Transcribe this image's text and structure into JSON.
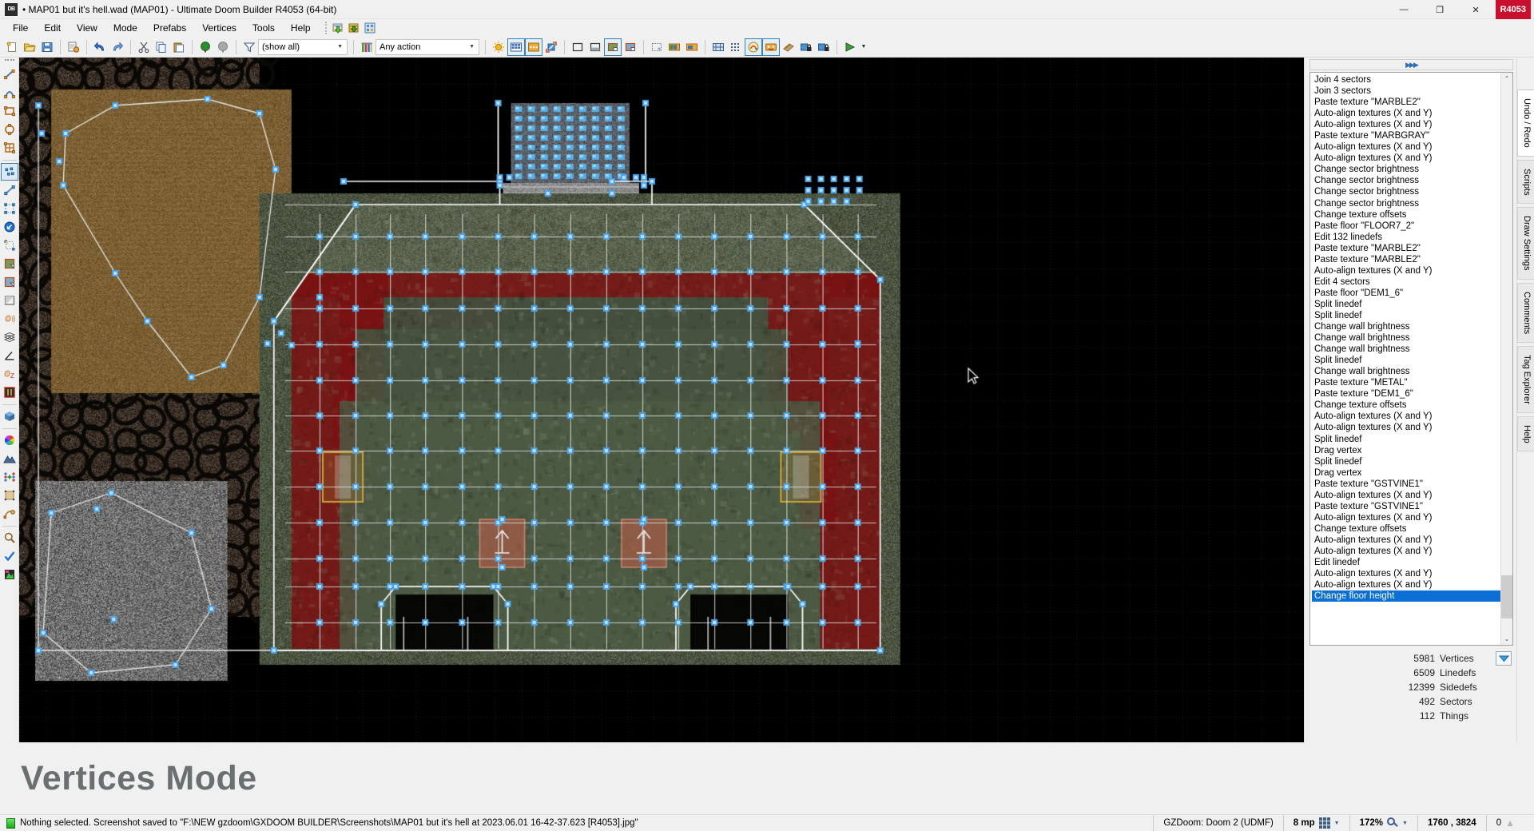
{
  "window": {
    "title": "• MAP01 but it's hell.wad (MAP01) - Ultimate Doom Builder R4053 (64-bit)",
    "app_icon_label": "DB",
    "minimize": "—",
    "maximize": "❐",
    "close": "✕",
    "revision_badge": "R4053"
  },
  "menubar": {
    "items": [
      {
        "label": "File",
        "name": "menu-file"
      },
      {
        "label": "Edit",
        "name": "menu-edit"
      },
      {
        "label": "View",
        "name": "menu-view"
      },
      {
        "label": "Mode",
        "name": "menu-mode"
      },
      {
        "label": "Prefabs",
        "name": "menu-prefabs"
      },
      {
        "label": "Vertices",
        "name": "menu-vertices"
      },
      {
        "label": "Tools",
        "name": "menu-tools"
      },
      {
        "label": "Help",
        "name": "menu-help"
      }
    ],
    "icons": [
      {
        "name": "import-wad-icon"
      },
      {
        "name": "export-wad-icon"
      },
      {
        "name": "script-editor-icon"
      }
    ]
  },
  "toolbar": {
    "groups": [
      {
        "name": "file-group",
        "buttons": [
          {
            "name": "new-map-button",
            "icon": "new-map-icon"
          },
          {
            "name": "open-map-button",
            "icon": "open-folder-icon"
          },
          {
            "name": "save-map-button",
            "icon": "floppy-save-icon"
          }
        ]
      },
      {
        "name": "map-options-group",
        "buttons": [
          {
            "name": "map-options-button",
            "icon": "map-options-icon"
          }
        ]
      },
      {
        "name": "undo-redo-group",
        "buttons": [
          {
            "name": "undo-button",
            "icon": "undo-arrow-icon"
          },
          {
            "name": "redo-button",
            "icon": "redo-arrow-icon"
          }
        ]
      },
      {
        "name": "clipboard-group",
        "buttons": [
          {
            "name": "cut-button",
            "icon": "scissors-icon"
          },
          {
            "name": "copy-button",
            "icon": "copy-icon"
          },
          {
            "name": "paste-button",
            "icon": "paste-icon"
          }
        ]
      },
      {
        "name": "thing-filter-group",
        "buttons": [
          {
            "name": "snap-to-grid-button",
            "icon": "green-tree-icon"
          },
          {
            "name": "auto-merge-button",
            "icon": "gray-tree-icon"
          }
        ]
      }
    ],
    "thing_filter": {
      "name": "thing-filter-combo",
      "value": "(show all)",
      "placeholder": "(show all)"
    },
    "action_filter": {
      "name": "action-filter-combo",
      "value": "Any action",
      "placeholder": "Any action",
      "icon": "pillars-icon"
    },
    "view_modes": [
      {
        "name": "view-brightness-button",
        "icon": "sun-icon",
        "checked": false
      },
      {
        "name": "view-floor-textures-button",
        "icon": "blue-grid-icon",
        "checked": true
      },
      {
        "name": "view-ceiling-textures-button",
        "icon": "orange-grid-icon",
        "checked": true
      },
      {
        "name": "view-normal-button",
        "icon": "blue-arrows-icon",
        "checked": false
      }
    ],
    "render_modes": [
      {
        "name": "render-wireframe-button",
        "icon": "wireframe-icon",
        "checked": false
      },
      {
        "name": "render-brightness-button",
        "icon": "brightness-icon",
        "checked": false
      },
      {
        "name": "render-floors-button",
        "icon": "floors-icon",
        "checked": true
      },
      {
        "name": "render-ceilings-button",
        "icon": "ceilings-icon",
        "checked": false
      }
    ],
    "selection_modes": [
      {
        "name": "dynamic-grid-button",
        "icon": "dotted-square-icon",
        "checked": false
      },
      {
        "name": "show-lights-button",
        "icon": "lights-icon",
        "checked": false
      },
      {
        "name": "show-models-button",
        "icon": "models-icon",
        "checked": false
      }
    ],
    "extra_modes": [
      {
        "name": "snap-vertices-button",
        "icon": "snap-icon",
        "checked": false
      },
      {
        "name": "grid-setup-button",
        "icon": "grid-dots-icon",
        "checked": false
      },
      {
        "name": "test-map-sound-button",
        "icon": "sound-prop-icon",
        "checked": true
      },
      {
        "name": "show-comments-button",
        "icon": "comments-face-icon",
        "checked": true
      },
      {
        "name": "texture-browse-button",
        "icon": "texture-icon",
        "checked": false
      },
      {
        "name": "lock-textures-button",
        "icon": "lock-blue-icon",
        "checked": false
      },
      {
        "name": "lock-heights-button",
        "icon": "lock-blue2-icon",
        "checked": false
      }
    ],
    "test_group": [
      {
        "name": "test-map-button",
        "icon": "green-play-icon"
      },
      {
        "name": "test-map-dropdown",
        "icon": "chevron-down-icon"
      }
    ]
  },
  "left_toolbar": {
    "items": [
      {
        "name": "draw-lines-tool",
        "icon": "draw-line-icon",
        "checked": false
      },
      {
        "name": "draw-curve-tool",
        "icon": "draw-curve-icon",
        "checked": false
      },
      {
        "name": "draw-rectangle-tool",
        "icon": "draw-rectangle-icon",
        "checked": false
      },
      {
        "name": "draw-ellipse-tool",
        "icon": "draw-ellipse-icon",
        "checked": false
      },
      {
        "name": "draw-grid-tool",
        "icon": "draw-grid-icon",
        "checked": false
      },
      {
        "name": "vertices-mode-tool",
        "icon": "vertices-mode-icon",
        "checked": true
      },
      {
        "name": "linedefs-mode-tool",
        "icon": "linedefs-mode-icon",
        "checked": false
      },
      {
        "name": "sectors-mode-tool",
        "icon": "sectors-mode-icon",
        "checked": false
      },
      {
        "name": "things-mode-tool",
        "icon": "things-mode-icon",
        "checked": false
      },
      {
        "name": "edit-selection-tool",
        "icon": "edit-selection-icon",
        "checked": false
      },
      {
        "name": "make-sector-tool",
        "icon": "make-sector-icon",
        "checked": false
      },
      {
        "name": "bridge-mode-tool",
        "icon": "bridge-mode-icon",
        "checked": false
      },
      {
        "name": "brightness-mode-tool",
        "icon": "brightness-mode-icon",
        "checked": false
      },
      {
        "name": "sound-propagation-tool",
        "icon": "sound-propagation-icon",
        "checked": false
      },
      {
        "name": "sector-slope-tool",
        "icon": "layers-icon",
        "checked": false
      },
      {
        "name": "find-angle-tool",
        "icon": "angle-icon",
        "checked": false
      },
      {
        "name": "sound-environment-tool",
        "icon": "sound-env-icon",
        "checked": false
      },
      {
        "name": "linedef-flags-tool",
        "icon": "linedef-flags-icon",
        "checked": false
      },
      {
        "name": "visual-mode-tool",
        "icon": "cube-icon",
        "checked": false
      },
      {
        "name": "color-picker-tool",
        "icon": "color-wheel-icon",
        "checked": false
      },
      {
        "name": "terrain-tool",
        "icon": "terrain-icon",
        "checked": false
      },
      {
        "name": "tag-range-tool",
        "icon": "tag-range-icon",
        "checked": false
      },
      {
        "name": "texture-align-tool",
        "icon": "texture-align-icon",
        "checked": false
      },
      {
        "name": "curve-linedefs-tool",
        "icon": "curve-linedefs-icon",
        "checked": false
      },
      {
        "name": "find-replace-tool",
        "icon": "magnifier-icon",
        "checked": false
      },
      {
        "name": "map-analysis-tool",
        "icon": "checkmark-icon",
        "checked": false
      },
      {
        "name": "screenshot-tool",
        "icon": "screenshot-icon",
        "checked": false
      }
    ]
  },
  "right_dock": {
    "header_icon": "chevrons-right-icon",
    "undo_list_title": "Undo / Redo",
    "undo_items": [
      "Join 4 sectors",
      "Join 3 sectors",
      "Paste texture \"MARBLE2\"",
      "Auto-align textures (X and Y)",
      "Auto-align textures (X and Y)",
      "Paste texture \"MARBGRAY\"",
      "Auto-align textures (X and Y)",
      "Auto-align textures (X and Y)",
      "Change sector brightness",
      "Change sector brightness",
      "Change sector brightness",
      "Change sector brightness",
      "Change texture offsets",
      "Paste floor \"FLOOR7_2\"",
      "Edit 132 linedefs",
      "Paste texture \"MARBLE2\"",
      "Paste texture \"MARBLE2\"",
      "Auto-align textures (X and Y)",
      "Edit 4 sectors",
      "Paste floor \"DEM1_6\"",
      "Split linedef",
      "Split linedef",
      "Change wall brightness",
      "Change wall brightness",
      "Change wall brightness",
      "Split linedef",
      "Change wall brightness",
      "Paste texture \"METAL\"",
      "Paste texture \"DEM1_6\"",
      "Change texture offsets",
      "Auto-align textures (X and Y)",
      "Auto-align textures (X and Y)",
      "Split linedef",
      "Drag vertex",
      "Split linedef",
      "Drag vertex",
      "Paste texture \"GSTVINE1\"",
      "Auto-align textures (X and Y)",
      "Paste texture \"GSTVINE1\"",
      "Auto-align textures (X and Y)",
      "Change texture offsets",
      "Auto-align textures (X and Y)",
      "Auto-align textures (X and Y)",
      "Edit linedef",
      "Auto-align textures (X and Y)",
      "Auto-align textures (X and Y)",
      "Change floor height"
    ],
    "selected_index": 46,
    "scroll_up_glyph": "⌃",
    "scroll_down_glyph": "⌄"
  },
  "vertical_tabs": [
    {
      "label": "Undo / Redo",
      "name": "tab-undo-redo",
      "active": true
    },
    {
      "label": "Scripts",
      "name": "tab-scripts",
      "active": false
    },
    {
      "label": "Draw Settings",
      "name": "tab-draw-settings",
      "active": false
    },
    {
      "label": "Comments",
      "name": "tab-comments",
      "active": false
    },
    {
      "label": "Tag Explorer",
      "name": "tab-tag-explorer",
      "active": false
    },
    {
      "label": "Help",
      "name": "tab-help",
      "active": false
    }
  ],
  "stats": {
    "collapse_glyph": "▼",
    "rows": [
      {
        "value": "5981",
        "label": "Vertices"
      },
      {
        "value": "6509",
        "label": "Linedefs"
      },
      {
        "value": "12399",
        "label": "Sidedefs"
      },
      {
        "value": "492",
        "label": "Sectors"
      },
      {
        "value": "112",
        "label": "Things"
      }
    ]
  },
  "mode_banner": {
    "text": "Vertices Mode"
  },
  "statusbar": {
    "led_state": "ready",
    "message": "Nothing selected. Screenshot saved to \"F:\\NEW gzdoom\\GXDOOM BUILDER\\Screenshots\\MAP01 but it's hell at 2023.06.01 16-42-37.623 [R4053].jpg\"",
    "game_config": "GZDoom: Doom 2 (UDMF)",
    "grid_size": "8 mp",
    "zoom": "172%",
    "coordinates": "1760 , 3824",
    "selection_count": "0"
  },
  "colors": {
    "accent": "#0b6fd6",
    "badge_red": "#c8102e",
    "banner_text": "#6a6f72",
    "chrome": "#f0f0f0",
    "canvas_bg": "#000000",
    "vertex": "#4aa3e8",
    "linedef": "#ffffff",
    "sector_red": "#8c1c1c",
    "sector_green": "#5d6b4a"
  },
  "canvas": {
    "name": "map-editor-canvas",
    "grid_visible": true,
    "cursor_position": "1760 , 3824"
  }
}
